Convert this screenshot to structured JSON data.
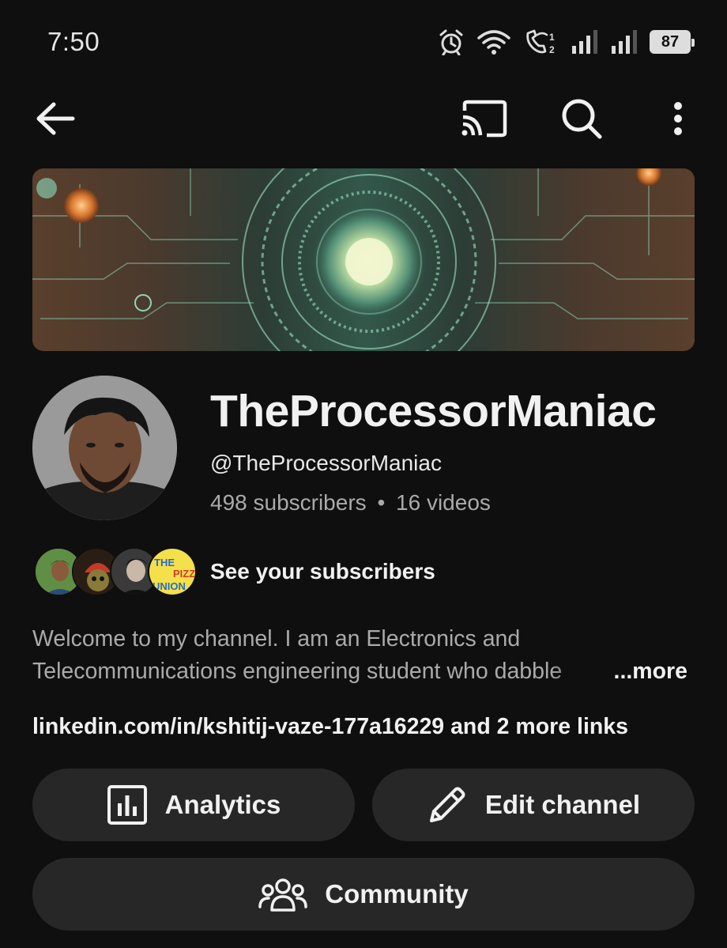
{
  "status_bar": {
    "time": "7:50",
    "battery": "87",
    "sim_indicator": "1 2"
  },
  "app_bar": {
    "back_icon": "arrow-back-icon",
    "cast_icon": "cast-icon",
    "search_icon": "search-icon",
    "more_icon": "more-vert-icon"
  },
  "channel": {
    "name": "TheProcessorManiac",
    "handle": "@TheProcessorManiac",
    "subscribers": "498 subscribers",
    "separator": "•",
    "videos": "16 videos",
    "see_subscribers": "See your subscribers",
    "description_line1": "Welcome to my channel. I am an Electronics and",
    "description_line2": "Telecommunications engineering student who dabble",
    "more_label": "...more",
    "links_text": "linkedin.com/in/kshitij-vaze-177a16229 and 2 more links"
  },
  "buttons": {
    "analytics": "Analytics",
    "edit_channel": "Edit channel",
    "community": "Community"
  },
  "subscriber_avatar_4_text": "THE PIZZA UNION",
  "colors": {
    "background": "#0f0f0f",
    "button_bg": "#272727",
    "primary_text": "#f1f1f1",
    "secondary_text": "#aaaaaa"
  }
}
